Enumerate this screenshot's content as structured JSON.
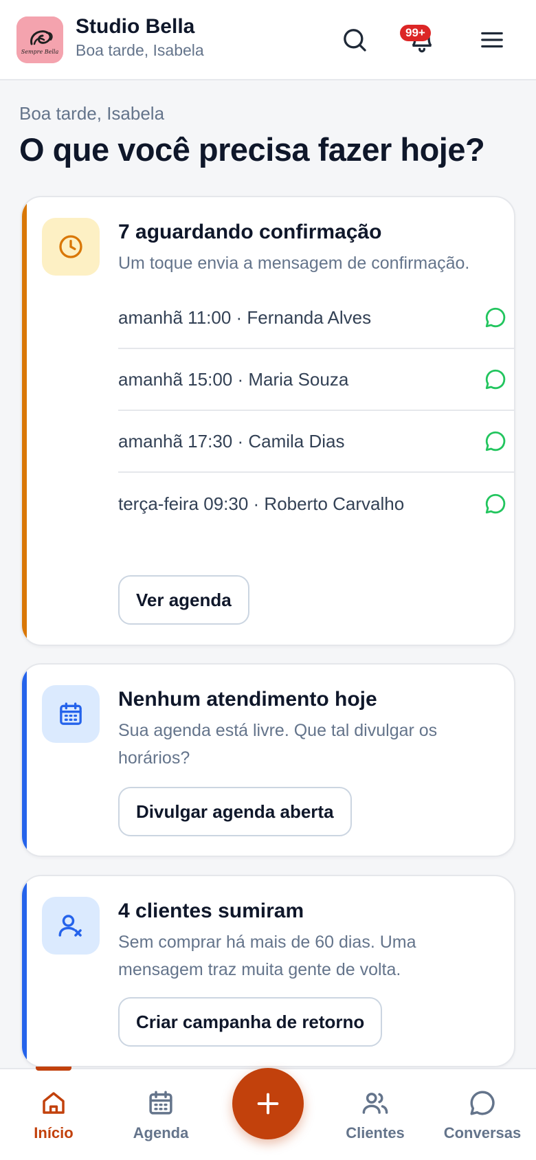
{
  "header": {
    "title": "Studio Bella",
    "subtitle": "Boa tarde, Isabela",
    "notification_badge": "99+",
    "logo_text": "Sempre Bella"
  },
  "main": {
    "greeting": "Boa tarde, Isabela",
    "title": "O que você precisa fazer hoje?"
  },
  "cards": {
    "pending": {
      "title": "7 aguardando confirmação",
      "description": "Um toque envia a mensagem de confirmação.",
      "appointments": [
        {
          "label": "amanhã 11:00 · Fernanda Alves"
        },
        {
          "label": "amanhã 15:00 · Maria Souza"
        },
        {
          "label": "amanhã 17:30 · Camila Dias"
        },
        {
          "label": "terça-feira 09:30 · Roberto Carvalho"
        }
      ],
      "button": "Ver agenda",
      "accent": "#d97706"
    },
    "today": {
      "title": "Nenhum atendimento hoje",
      "description": "Sua agenda está livre. Que tal divulgar os horários?",
      "button": "Divulgar agenda aberta",
      "accent": "#2563eb"
    },
    "missing": {
      "title": "4 clientes sumiram",
      "description": "Sem comprar há mais de 60 dias. Uma mensagem traz muita gente de volta.",
      "button": "Criar campanha de retorno",
      "accent": "#2563eb"
    }
  },
  "nav": {
    "home": "Início",
    "agenda": "Agenda",
    "clients": "Clientes",
    "chats": "Conversas"
  },
  "colors": {
    "brand": "#c2410c",
    "whatsapp": "#22c55e",
    "badge": "#dc2626"
  }
}
